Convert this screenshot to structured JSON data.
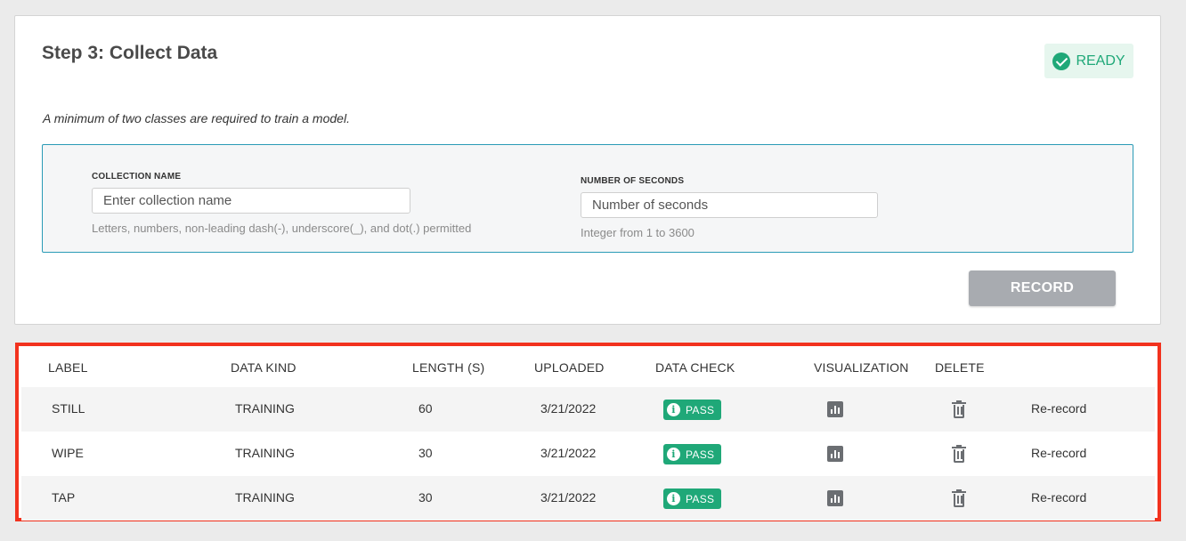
{
  "step": {
    "title": "Step 3: Collect Data",
    "status": "READY",
    "note": "A minimum of two classes are required to train a model."
  },
  "form": {
    "collection": {
      "label": "COLLECTION NAME",
      "placeholder": "Enter collection name",
      "value": "",
      "hint": "Letters, numbers, non-leading dash(-), underscore(_), and dot(.) permitted"
    },
    "seconds": {
      "label": "NUMBER OF SECONDS",
      "placeholder": "Number of seconds",
      "value": "",
      "hint": "Integer from 1 to 3600"
    },
    "record_label": "RECORD"
  },
  "table": {
    "headers": [
      "LABEL",
      "DATA KIND",
      "LENGTH (S)",
      "UPLOADED",
      "DATA CHECK",
      "VISUALIZATION",
      "DELETE"
    ],
    "rows": [
      {
        "label": "STILL",
        "kind": "TRAINING",
        "length": "60",
        "uploaded": "3/21/2022",
        "check": "PASS",
        "action": "Re-record"
      },
      {
        "label": "WIPE",
        "kind": "TRAINING",
        "length": "30",
        "uploaded": "3/21/2022",
        "check": "PASS",
        "action": "Re-record"
      },
      {
        "label": "TAP",
        "kind": "TRAINING",
        "length": "30",
        "uploaded": "3/21/2022",
        "check": "PASS",
        "action": "Re-record"
      }
    ]
  },
  "icons": {
    "status": "check-circle-icon",
    "check": "info-icon",
    "visualization": "bar-chart-icon",
    "delete": "trash-icon"
  },
  "colors": {
    "accent_green": "#1fa878",
    "form_border": "#2a9bb6",
    "highlight_border": "#f2321e",
    "record_disabled": "#a8abb0"
  }
}
